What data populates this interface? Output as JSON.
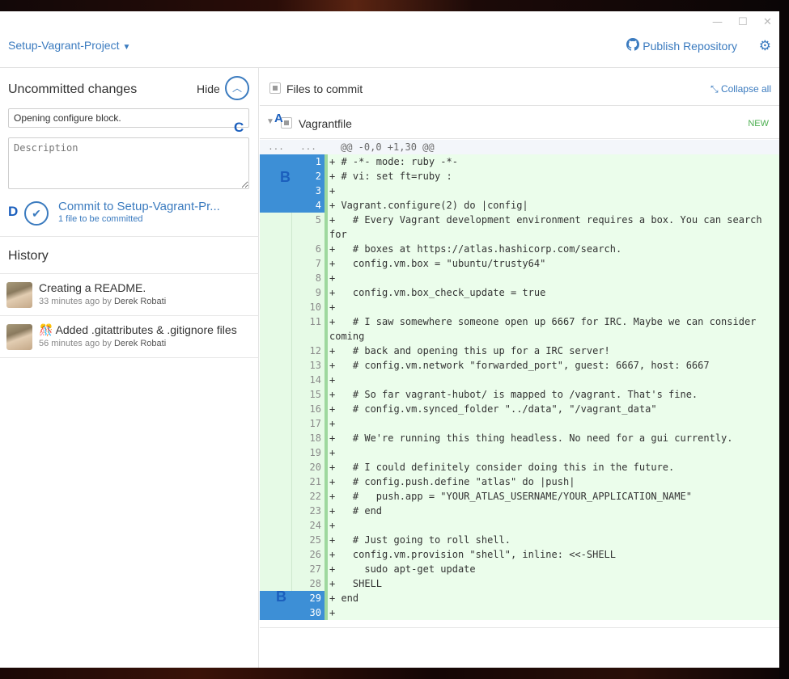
{
  "window": {
    "repo_name": "Setup-Vagrant-Project",
    "minimize_glyph": "—",
    "maximize_glyph": "☐",
    "close_glyph": "✕",
    "publish_label": "Publish Repository"
  },
  "commit_panel": {
    "title": "Uncommitted changes",
    "hide_label": "Hide",
    "summary_value": "Opening configure block.",
    "description_placeholder": "Description",
    "commit_button_label": "Commit to Setup-Vagrant-Pr...",
    "commit_subtitle": "1 file to be committed"
  },
  "annotations": {
    "a": "A",
    "b": "B",
    "c": "C",
    "d": "D"
  },
  "history": {
    "title": "History",
    "items": [
      {
        "title": "Creating a README.",
        "time": "33 minutes ago by ",
        "author": "Derek Robati",
        "emoji": ""
      },
      {
        "title": "Added .gitattributes & .gitignore files",
        "time": "56 minutes ago by ",
        "author": "Derek Robati",
        "emoji": "🎊"
      }
    ]
  },
  "files": {
    "header_label": "Files to commit",
    "collapse_label": "Collapse all",
    "file_name": "Vagrantfile",
    "file_status": "NEW"
  },
  "diff": {
    "hunk_dots_left": "...",
    "hunk_dots_right": "...",
    "hunk_header": "@@ -0,0 +1,30 @@",
    "lines": [
      {
        "n": "1",
        "t": "+ # -*- mode: ruby -*-",
        "sel": true
      },
      {
        "n": "2",
        "t": "+ # vi: set ft=ruby :",
        "sel": true
      },
      {
        "n": "3",
        "t": "+",
        "sel": true
      },
      {
        "n": "4",
        "t": "+ Vagrant.configure(2) do |config|",
        "sel": true
      },
      {
        "n": "5",
        "t": "+   # Every Vagrant development environment requires a box. You can search for",
        "wrap": true
      },
      {
        "n": "6",
        "t": "+   # boxes at https://atlas.hashicorp.com/search."
      },
      {
        "n": "7",
        "t": "+   config.vm.box = \"ubuntu/trusty64\""
      },
      {
        "n": "8",
        "t": "+"
      },
      {
        "n": "9",
        "t": "+   config.vm.box_check_update = true"
      },
      {
        "n": "10",
        "t": "+"
      },
      {
        "n": "11",
        "t": "+   # I saw somewhere someone open up 6667 for IRC. Maybe we can consider coming",
        "wrap": true
      },
      {
        "n": "12",
        "t": "+   # back and opening this up for a IRC server!"
      },
      {
        "n": "13",
        "t": "+   # config.vm.network \"forwarded_port\", guest: 6667, host: 6667"
      },
      {
        "n": "14",
        "t": "+"
      },
      {
        "n": "15",
        "t": "+   # So far vagrant-hubot/ is mapped to /vagrant. That's fine."
      },
      {
        "n": "16",
        "t": "+   # config.vm.synced_folder \"../data\", \"/vagrant_data\""
      },
      {
        "n": "17",
        "t": "+"
      },
      {
        "n": "18",
        "t": "+   # We're running this thing headless. No need for a gui currently."
      },
      {
        "n": "19",
        "t": "+"
      },
      {
        "n": "20",
        "t": "+   # I could definitely consider doing this in the future."
      },
      {
        "n": "21",
        "t": "+   # config.push.define \"atlas\" do |push|"
      },
      {
        "n": "22",
        "t": "+   #   push.app = \"YOUR_ATLAS_USERNAME/YOUR_APPLICATION_NAME\""
      },
      {
        "n": "23",
        "t": "+   # end"
      },
      {
        "n": "24",
        "t": "+"
      },
      {
        "n": "25",
        "t": "+   # Just going to roll shell."
      },
      {
        "n": "26",
        "t": "+   config.vm.provision \"shell\", inline: <<-SHELL"
      },
      {
        "n": "27",
        "t": "+     sudo apt-get update"
      },
      {
        "n": "28",
        "t": "+   SHELL"
      },
      {
        "n": "29",
        "t": "+ end",
        "sel": true
      },
      {
        "n": "30",
        "t": "+",
        "sel": true
      }
    ]
  },
  "colors": {
    "accent": "#3b7bbf",
    "annotation": "#1b5fbd",
    "selected_gutter": "#3d8fd6",
    "added_line_bg": "#ebfdeb",
    "new_badge": "#4caf50"
  }
}
